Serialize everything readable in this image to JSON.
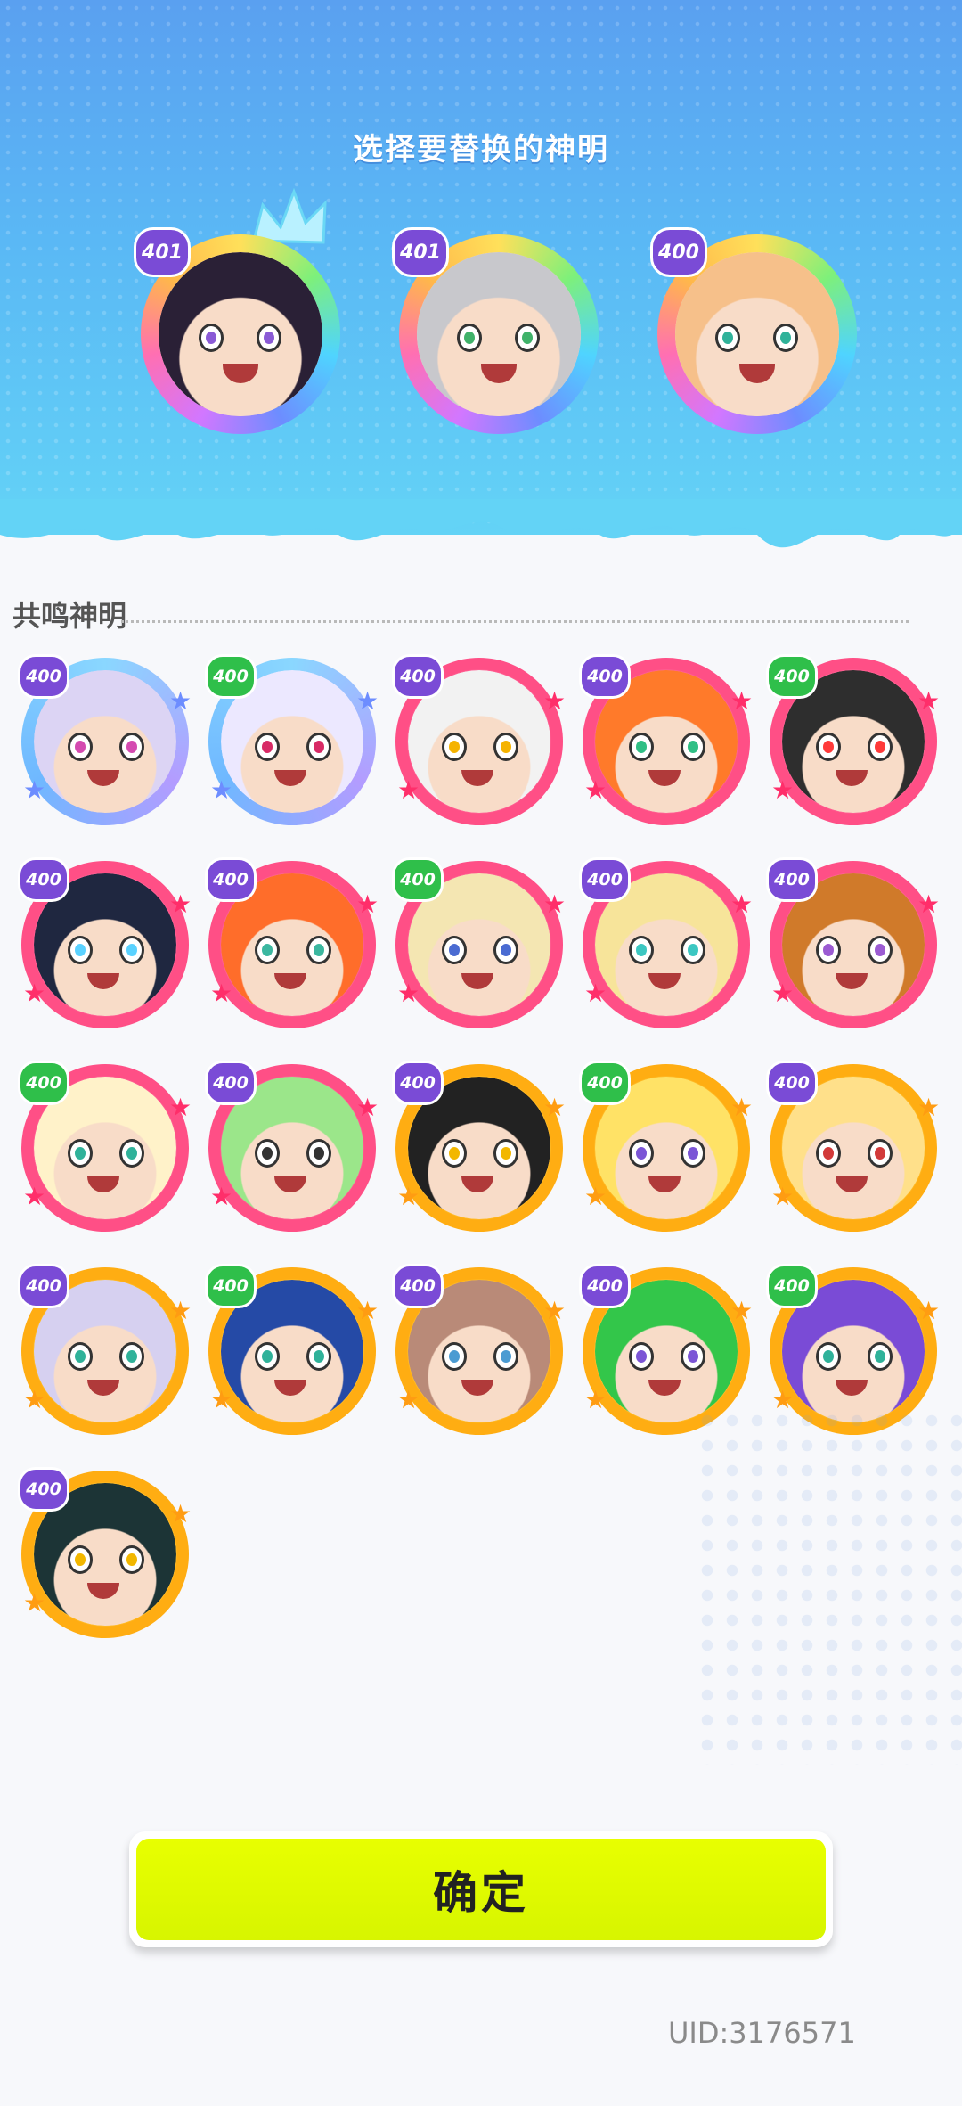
{
  "header": {
    "title": "选择要替换的神明",
    "selected": [
      {
        "badge": "401",
        "name": "selected-god-1"
      },
      {
        "badge": "401",
        "name": "selected-god-2"
      },
      {
        "badge": "400",
        "name": "selected-god-3"
      }
    ]
  },
  "section": {
    "title": "共鸣神明"
  },
  "gods": [
    {
      "badge": "400",
      "ring": "blue",
      "hair": "#dcd4f4",
      "eye": "#d44ab0"
    },
    {
      "badge": "400",
      "ring": "blue",
      "hair": "#ece8ff",
      "eye": "#d82a66"
    },
    {
      "badge": "400",
      "ring": "pink",
      "hair": "#f2f2f2",
      "eye": "#f5b300"
    },
    {
      "badge": "400",
      "ring": "pink",
      "hair": "#ff7a2a",
      "eye": "#2fbf85"
    },
    {
      "badge": "400",
      "ring": "pink",
      "hair": "#2e2e2e",
      "eye": "#ff3a3a"
    },
    {
      "badge": "400",
      "ring": "pink",
      "hair": "#1f2740",
      "eye": "#5ad2ff"
    },
    {
      "badge": "400",
      "ring": "pink",
      "hair": "#ff6d2a",
      "eye": "#3bb7a0"
    },
    {
      "badge": "400",
      "ring": "pink",
      "hair": "#f4e6b2",
      "eye": "#4a6bd2"
    },
    {
      "badge": "400",
      "ring": "pink",
      "hair": "#f7e49a",
      "eye": "#3cc7c2"
    },
    {
      "badge": "400",
      "ring": "pink",
      "hair": "#d07a2a",
      "eye": "#9b5bd2"
    },
    {
      "badge": "400",
      "ring": "pink",
      "hair": "#fff2c9",
      "eye": "#2fb29a"
    },
    {
      "badge": "400",
      "ring": "pink",
      "hair": "#9be68a",
      "eye": "#333333"
    },
    {
      "badge": "400",
      "ring": "orange",
      "hair": "#222222",
      "eye": "#f2b700"
    },
    {
      "badge": "400",
      "ring": "orange",
      "hair": "#ffe266",
      "eye": "#7b55d6"
    },
    {
      "badge": "400",
      "ring": "orange",
      "hair": "#ffe08a",
      "eye": "#d23a3a"
    },
    {
      "badge": "400",
      "ring": "orange",
      "hair": "#d6d0f0",
      "eye": "#2fb29a"
    },
    {
      "badge": "400",
      "ring": "orange",
      "hair": "#254aa6",
      "eye": "#2fb29a"
    },
    {
      "badge": "400",
      "ring": "orange",
      "hair": "#b98a78",
      "eye": "#4a9bd2"
    },
    {
      "badge": "400",
      "ring": "orange",
      "hair": "#33c64a",
      "eye": "#7b55d6"
    },
    {
      "badge": "400",
      "ring": "orange",
      "hair": "#7a4bd6",
      "eye": "#2fb29a"
    },
    {
      "badge": "400",
      "ring": "orange",
      "hair": "#1c3436",
      "eye": "#f2b700"
    }
  ],
  "footer": {
    "confirm_label": "确定",
    "uid": "UID:3176571"
  },
  "colors": {
    "confirm": "#e3ff00",
    "badge_purple": "#7a4bd6",
    "badge_green": "#2fbf4a"
  }
}
